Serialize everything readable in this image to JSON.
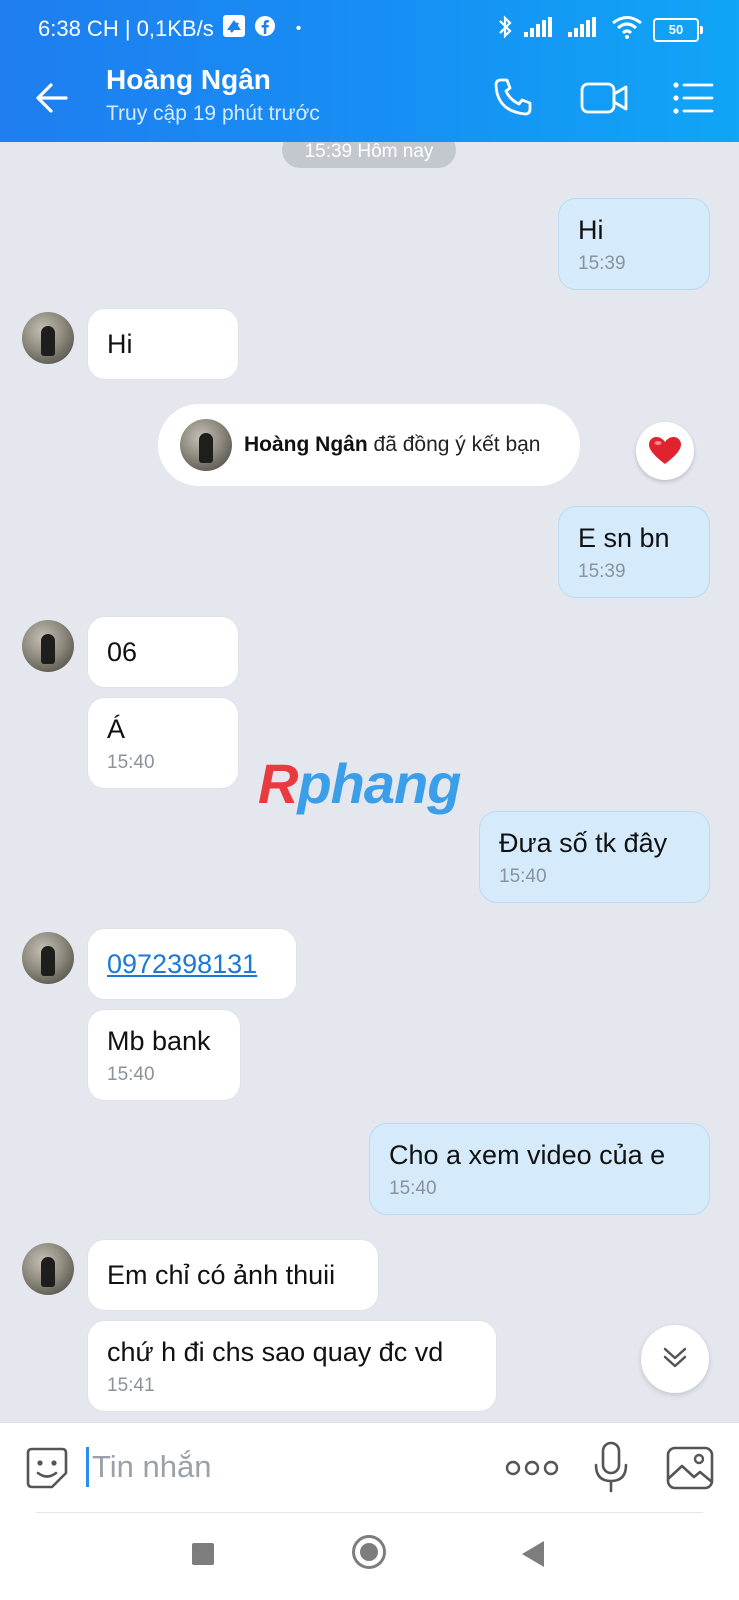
{
  "status_bar": {
    "time_speed": "6:38 CH | 0,1KB/s",
    "dot": "•",
    "battery": "50"
  },
  "header": {
    "contact_name": "Hoàng Ngân",
    "contact_status": "Truy cập 19 phút trước",
    "icons": [
      "back-arrow-icon",
      "phone-icon",
      "video-camera-icon",
      "list-menu-icon"
    ]
  },
  "chat": {
    "date_separator": "15:39 Hôm nay",
    "messages": [
      {
        "from": "me",
        "text": "Hi",
        "time": "15:39"
      },
      {
        "from": "them",
        "text": "Hi",
        "time": ""
      },
      {
        "from": "me",
        "text": "E sn bn",
        "time": "15:39"
      },
      {
        "from": "them",
        "text": "06",
        "time": ""
      },
      {
        "from": "them",
        "text": "Á",
        "time": "15:40"
      },
      {
        "from": "me",
        "text": "Đưa số tk đây",
        "time": "15:40"
      },
      {
        "from": "them",
        "text": "0972398131",
        "time": ""
      },
      {
        "from": "them",
        "text": "Mb bank",
        "time": "15:40"
      },
      {
        "from": "me",
        "text": "Cho a xem video của e",
        "time": "15:40"
      },
      {
        "from": "them",
        "text": "Em chỉ có ảnh thuii",
        "time": ""
      },
      {
        "from": "them",
        "text": "chứ h đi chs sao quay đc vd",
        "time": "15:41"
      }
    ],
    "friend_notice": {
      "name": "Hoàng Ngân",
      "text": "đã đồng ý kết bạn",
      "reaction": "heart-icon"
    }
  },
  "watermark": {
    "brand_r": "R",
    "brand_rest": "phang",
    "colors": {
      "r": "#e83a3f",
      "rest": "#3b9ee8"
    }
  },
  "composer": {
    "placeholder": "Tin nhắn",
    "icons": [
      "sticker-icon",
      "more-dots-icon",
      "microphone-icon",
      "gallery-icon"
    ]
  },
  "colors": {
    "header_gradient_start": "#1f7ef0",
    "header_gradient_end": "#10a5f6",
    "my_bubble": "#d5ebfb",
    "their_bubble": "#ffffff",
    "chat_background": "#e4e8ee",
    "link": "#1a7ad6"
  }
}
